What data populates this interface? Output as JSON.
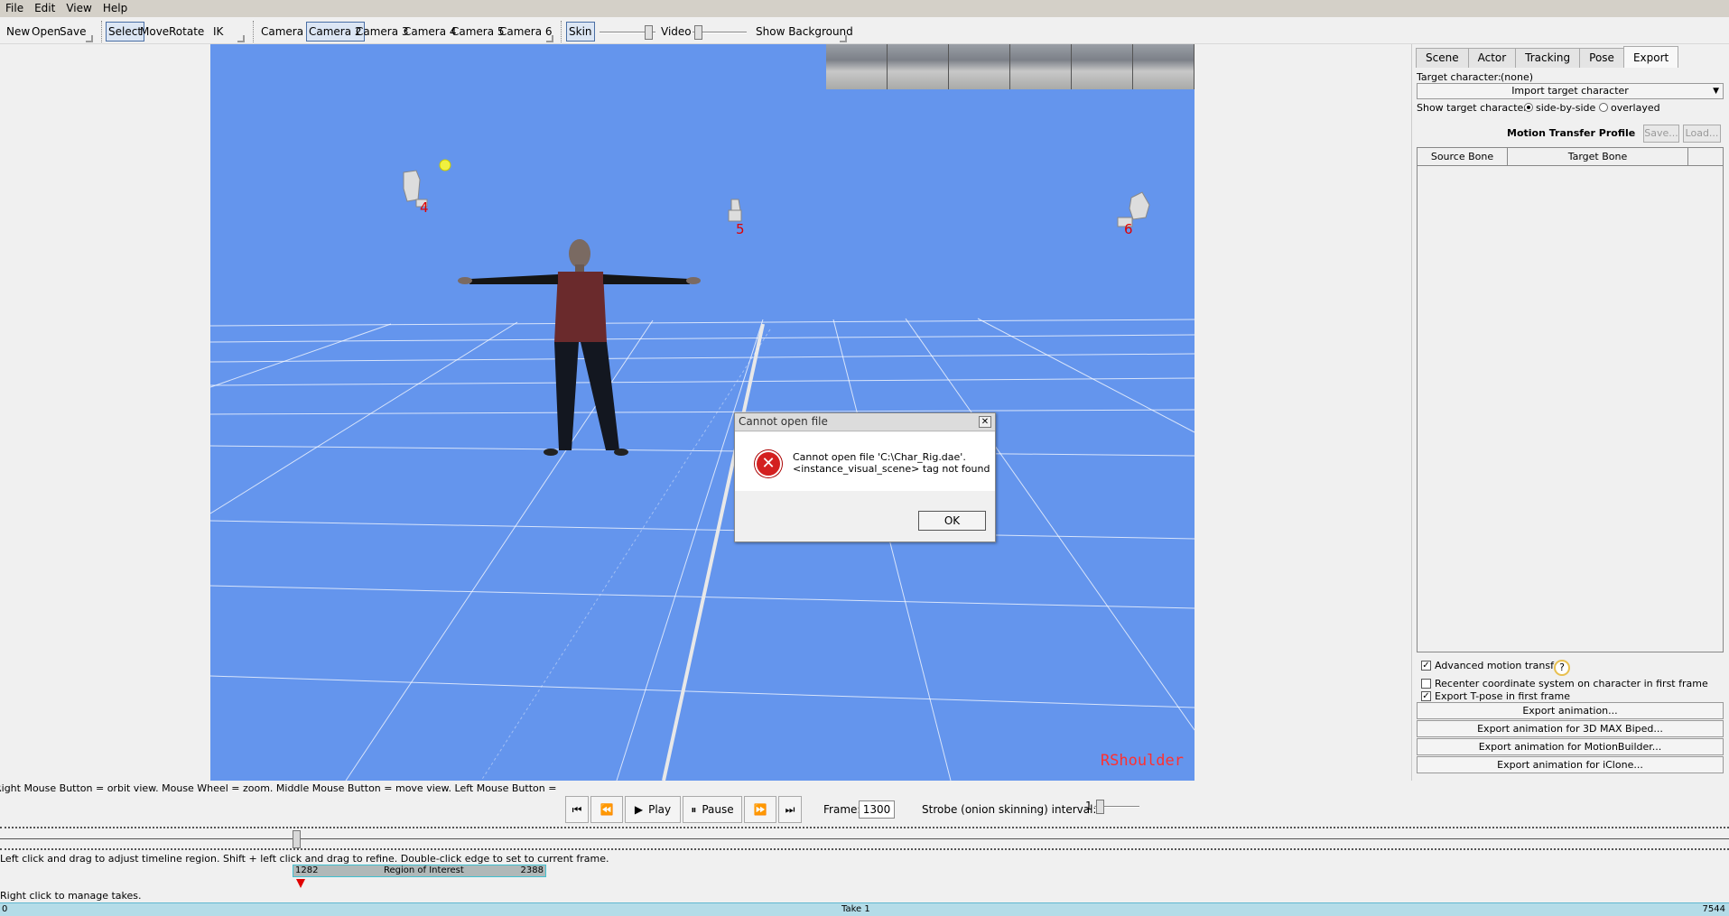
{
  "menu": [
    "File",
    "Edit",
    "View",
    "Help"
  ],
  "toolbar": {
    "new": "New",
    "open": "Open",
    "save": "Save",
    "select": "Select",
    "move": "Move",
    "rotate": "Rotate",
    "ik": "IK",
    "cameras": [
      "Camera 1",
      "Camera 2",
      "Camera 3",
      "Camera 4",
      "Camera 5",
      "Camera 6"
    ],
    "skin": "Skin",
    "video": "Video",
    "show_background": "Show Background"
  },
  "viewport": {
    "camera_labels": [
      "4",
      "5",
      "6"
    ],
    "bone_label": "RShoulder",
    "colors": {
      "background": "#6495ed",
      "bone_label": "#ff3030",
      "camera_label": "#e00000"
    }
  },
  "hints": {
    "viewport": "Right Mouse Button = orbit view. Mouse Wheel = zoom. Middle Mouse Button = move view. Left Mouse Button = select.",
    "timeline": "Left click and drag to adjust timeline region. Shift + left click and drag to refine. Double-click edge to set to current frame.",
    "takes": "Right click to manage takes."
  },
  "transport": {
    "play": "Play",
    "pause": "Pause",
    "frame_label": "Frame:",
    "frame_value": "1300",
    "strobe_label": "Strobe (onion skinning) interval:",
    "strobe_value": "1"
  },
  "timeline": {
    "roi_start": "1282",
    "roi_label": "Region of Interest",
    "roi_end": "2388",
    "take_start": "0",
    "take_label": "Take 1",
    "take_end": "7544"
  },
  "panel": {
    "tabs": [
      "Scene",
      "Actor",
      "Tracking",
      "Pose",
      "Export"
    ],
    "target_character_label": "Target character:",
    "target_character_value": "(none)",
    "import_target": "Import target character",
    "show_target_label": "Show target character:",
    "side_by_side": "side-by-side",
    "overlayed": "overlayed",
    "motion_profile": "Motion Transfer Profile",
    "save_btn": "Save...",
    "load_btn": "Load...",
    "columns": [
      "Source Bone",
      "Target Bone"
    ],
    "advanced": "Advanced motion transfer.",
    "help": "?",
    "recenter": "Recenter coordinate system on character in first frame",
    "export_tpose": "Export T-pose in first frame",
    "export_buttons": [
      "Export animation...",
      "Export animation for 3D MAX Biped...",
      "Export animation for MotionBuilder...",
      "Export animation for iClone..."
    ]
  },
  "dialog": {
    "title": "Cannot open file",
    "line1": "Cannot open file 'C:\\Char_Rig.dae'.",
    "line2": "<instance_visual_scene> tag not found",
    "ok": "OK",
    "close": "✕"
  }
}
